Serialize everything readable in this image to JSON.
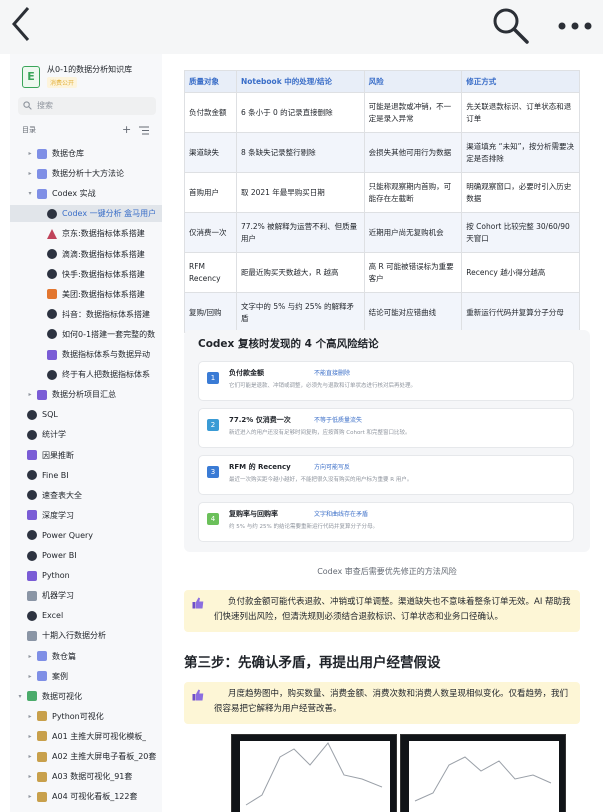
{
  "sidebar": {
    "kb_title": "从0-1的数据分析知识库",
    "kb_subtitle": "消费公开",
    "search_placeholder": "搜索",
    "directory_label": "目录",
    "items": [
      {
        "label": "数据仓库",
        "indent": 1,
        "icon": "folder-icon",
        "caret": "▸"
      },
      {
        "label": "数据分析十大方法论",
        "indent": 1,
        "icon": "folder-icon",
        "caret": "▸"
      },
      {
        "label": "Codex 实战",
        "indent": 1,
        "icon": "folder-icon",
        "caret": "▾"
      },
      {
        "label": "Codex 一键分析 盒马用户",
        "indent": 2,
        "icon": "infinity-icon",
        "caret": "",
        "active": true
      },
      {
        "label": "京东:数据指标体系搭建",
        "indent": 2,
        "icon": "triangle-icon",
        "caret": ""
      },
      {
        "label": "滴滴:数据指标体系搭建",
        "indent": 2,
        "icon": "circle-icon",
        "caret": ""
      },
      {
        "label": "快手:数据指标体系搭建",
        "indent": 2,
        "icon": "circle-icon",
        "caret": ""
      },
      {
        "label": "美团:数据指标体系搭建",
        "indent": 2,
        "icon": "pen-icon",
        "caret": ""
      },
      {
        "label": "抖音：数据指标体系搭建",
        "indent": 2,
        "icon": "circle-icon",
        "caret": ""
      },
      {
        "label": "如何0-1搭建一套完整的数",
        "indent": 2,
        "icon": "circle-icon",
        "caret": ""
      },
      {
        "label": "数据指标体系与数据异动",
        "indent": 2,
        "icon": "book-icon",
        "caret": ""
      },
      {
        "label": "终于有人把数据指标体系",
        "indent": 2,
        "icon": "circle-icon",
        "caret": ""
      },
      {
        "label": "数据分析项目汇总",
        "indent": 1,
        "icon": "book-icon",
        "caret": "▸"
      },
      {
        "label": "SQL",
        "indent": 0,
        "icon": "circle-icon",
        "caret": ""
      },
      {
        "label": "统计学",
        "indent": 0,
        "icon": "circle-icon",
        "caret": ""
      },
      {
        "label": "因果推断",
        "indent": 0,
        "icon": "book-icon",
        "caret": ""
      },
      {
        "label": "Fine BI",
        "indent": 0,
        "icon": "circle-icon",
        "caret": ""
      },
      {
        "label": "速查表大全",
        "indent": 0,
        "icon": "circle-icon",
        "caret": ""
      },
      {
        "label": "深度学习",
        "indent": 0,
        "icon": "book-icon",
        "caret": ""
      },
      {
        "label": "Power Query",
        "indent": 0,
        "icon": "circle-icon",
        "caret": ""
      },
      {
        "label": "Power BI",
        "indent": 0,
        "icon": "circle-icon",
        "caret": ""
      },
      {
        "label": "Python",
        "indent": 0,
        "icon": "book-icon",
        "caret": ""
      },
      {
        "label": "机器学习",
        "indent": 0,
        "icon": "doc-icon",
        "caret": ""
      },
      {
        "label": "Excel",
        "indent": 0,
        "icon": "circle-icon",
        "caret": ""
      },
      {
        "label": "十期入行数据分析",
        "indent": 0,
        "icon": "doc-icon",
        "caret": ""
      },
      {
        "label": "数仓篇",
        "indent": 1,
        "icon": "folder-icon",
        "caret": "▸"
      },
      {
        "label": "案例",
        "indent": 1,
        "icon": "folder-icon",
        "caret": "▸"
      },
      {
        "label": "数据可视化",
        "indent": 0,
        "icon": "green-icon",
        "caret": "▾"
      },
      {
        "label": "Python可视化",
        "indent": 1,
        "icon": "chart-icon",
        "caret": "▸"
      },
      {
        "label": "A01 主推大屏可视化模板_",
        "indent": 1,
        "icon": "chart-icon",
        "caret": "▸"
      },
      {
        "label": "A02 主推大屏电子看板_20套",
        "indent": 1,
        "icon": "chart-icon",
        "caret": "▸"
      },
      {
        "label": "A03 数据可视化_91套",
        "indent": 1,
        "icon": "chart-icon",
        "caret": "▸"
      },
      {
        "label": "A04 可视化看板_122套",
        "indent": 1,
        "icon": "chart-icon",
        "caret": "▸"
      }
    ]
  },
  "table": {
    "headers": [
      "质量对象",
      "Notebook 中的处理/结论",
      "风险",
      "修正方式"
    ],
    "rows": [
      [
        "负付款金额",
        "6 条小于 0 的记录直接删除",
        "可能是退款或冲销，不一定是录入异常",
        "先关联退款标识、订单状态和退订单"
      ],
      [
        "渠道缺失",
        "8 条缺失记录整行剔除",
        "会损失其他可用行为数据",
        "渠道填充 “未知”，按分析需要决定是否排除"
      ],
      [
        "首购用户",
        "取 2021 年最早购买日期",
        "只能称观察期内首购，可能存在左截断",
        "明确观察窗口，必要时引入历史数据"
      ],
      [
        "仅消费一次",
        "77.2% 被解释为运营不利、但质量用户",
        "近期用户尚无复购机会",
        "按 Cohort 比较完整 30/60/90 天窗口"
      ],
      [
        "RFM Recency",
        "距最近购买天数越大，R 越高",
        "高 R 可能被错误标为重要客户",
        "Recency 越小得分越高"
      ],
      [
        "复购/回购",
        "文字中的 5% 与约 25% 的解释矛盾",
        "结论可能对应错曲线",
        "重新运行代码并复算分子分母"
      ]
    ]
  },
  "figure": {
    "title": "Codex 复核时发现的 4 个高风险结论",
    "cards": [
      {
        "num": "1",
        "title": "负付款金额",
        "tag": "不能直接删除",
        "desc": "它们可能是退款、冲销或调整，必须先与退款和订单状态进行核对后再处理。",
        "color": "#3a7bd5"
      },
      {
        "num": "2",
        "title": "77.2% 仅消费一次",
        "tag": "不等于低质量流失",
        "desc": "新近进入的用户还没有足够时间复购，应按首购 Cohort 和完整窗口比较。",
        "color": "#3a9bd5"
      },
      {
        "num": "3",
        "title": "RFM 的 Recency",
        "tag": "方向可能写反",
        "desc": "最近一次购买距今越小越好，不能把很久没有购买的用户标为重要 R 用户。",
        "color": "#3a7bd5"
      },
      {
        "num": "4",
        "title": "复购率与回购率",
        "tag": "文字和曲线存在矛盾",
        "desc": "约 5% 与约 25% 的结论需要重新运行代码并复算分子分母。",
        "color": "#6bc05a"
      }
    ],
    "caption": "Codex 审查后需要优先修正的方法风险"
  },
  "callout1": {
    "text": "负付款金额可能代表退款、冲销或订单调整。渠道缺失也不意味着整条订单无效。AI 帮助我们快速列出风险，但清洗规则必须结合退款标识、订单状态和业务口径确认。"
  },
  "heading": {
    "text": "第三步：先确认矛盾，再提出用户经营假设"
  },
  "callout2": {
    "text": "月度趋势图中，购买数量、消费金额、消费次数和消费人数呈现相似变化。仅看趋势，我们很容易把它解释为用户经营改善。"
  }
}
